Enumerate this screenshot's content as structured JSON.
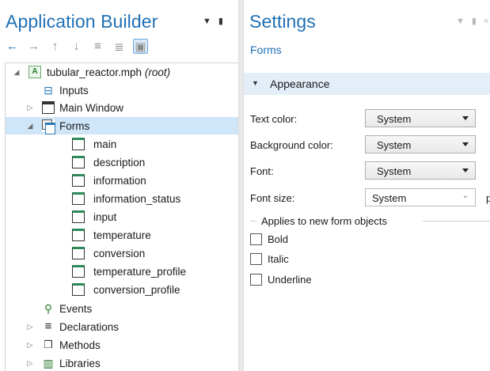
{
  "app_builder": {
    "title": "Application Builder",
    "toolbar": [
      {
        "name": "back-arrow-icon",
        "glyph": "←"
      },
      {
        "name": "forward-arrow-icon",
        "glyph": "→"
      },
      {
        "name": "move-up-icon",
        "glyph": "↑"
      },
      {
        "name": "move-down-icon",
        "glyph": "↓"
      },
      {
        "name": "expand-all-icon",
        "glyph": "≡"
      },
      {
        "name": "collapse-all-icon",
        "glyph": "≣"
      },
      {
        "name": "show-icon",
        "glyph": "▣"
      }
    ],
    "tree": {
      "root_label": "tubular_reactor.mph",
      "root_suffix": "(root)",
      "root_icon_letter": "A",
      "items": [
        {
          "label": "Inputs",
          "icon": "inputs-icon"
        },
        {
          "label": "Main Window",
          "icon": "window-icon"
        },
        {
          "label": "Forms",
          "icon": "forms-icon"
        },
        {
          "label": "main",
          "icon": "form-icon"
        },
        {
          "label": "description",
          "icon": "form-icon"
        },
        {
          "label": "information",
          "icon": "form-icon"
        },
        {
          "label": "information_status",
          "icon": "form-icon"
        },
        {
          "label": "input",
          "icon": "form-icon"
        },
        {
          "label": "temperature",
          "icon": "form-icon"
        },
        {
          "label": "conversion",
          "icon": "form-icon"
        },
        {
          "label": "temperature_profile",
          "icon": "form-icon"
        },
        {
          "label": "conversion_profile",
          "icon": "form-icon"
        },
        {
          "label": "Events",
          "icon": "events-icon"
        },
        {
          "label": "Declarations",
          "icon": "declarations-icon"
        },
        {
          "label": "Methods",
          "icon": "methods-icon"
        },
        {
          "label": "Libraries",
          "icon": "libraries-icon"
        }
      ]
    }
  },
  "settings": {
    "title": "Settings",
    "subtitle": "Forms",
    "section": "Appearance",
    "fields": {
      "text_color": {
        "label": "Text color:",
        "value": "System"
      },
      "background_color": {
        "label": "Background color:",
        "value": "System"
      },
      "font": {
        "label": "Font:",
        "value": "System"
      },
      "font_size": {
        "label": "Font size:",
        "value": "System",
        "unit": "pt"
      }
    },
    "group_label": "Applies to new form objects",
    "checkboxes": {
      "bold": {
        "label": "Bold",
        "checked": false
      },
      "italic": {
        "label": "Italic",
        "checked": false
      },
      "underline": {
        "label": "Underline",
        "checked": false
      }
    }
  },
  "colors": {
    "accent": "#1f6fb5",
    "selection": "#cfe5f8",
    "section_bar": "#e3eef8"
  }
}
